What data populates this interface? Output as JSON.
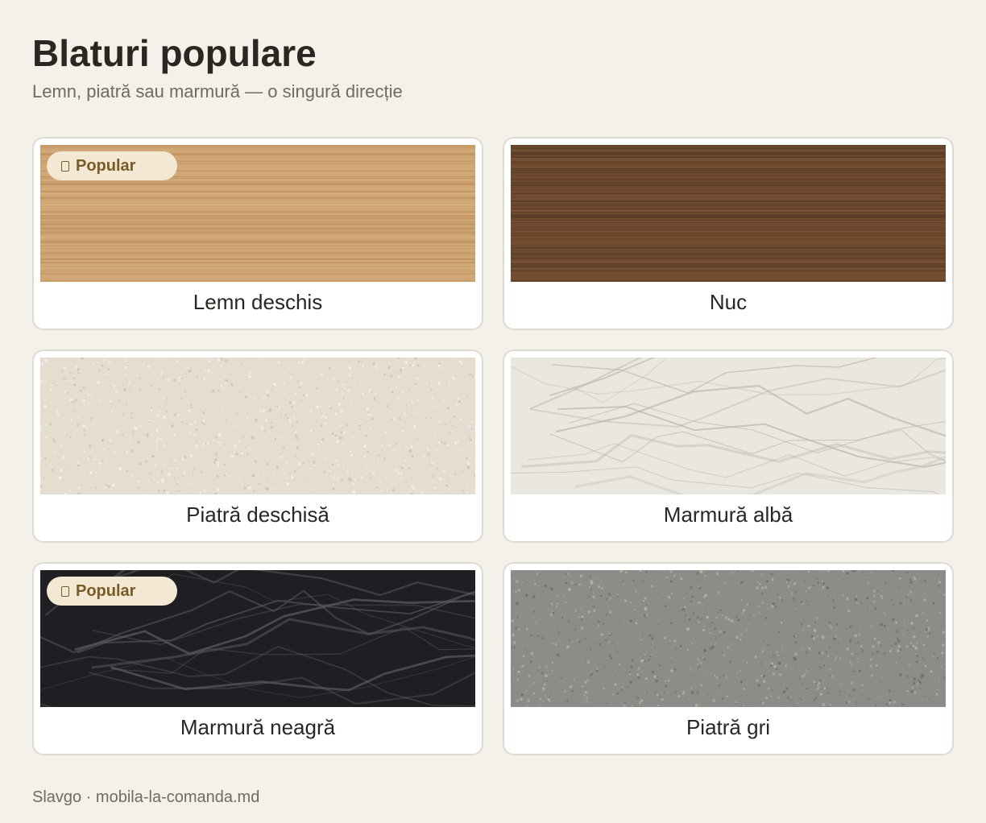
{
  "header": {
    "title": "Blaturi populare",
    "subtitle": "Lemn, piatră sau marmură — o singură direcție"
  },
  "badge_label": "Popular",
  "cards": [
    {
      "label": "Lemn deschis",
      "popular": true,
      "texture": "wood",
      "colors": {
        "base": "#cea472",
        "light": "#dbb485",
        "dark": "#b98b57"
      }
    },
    {
      "label": "Nuc",
      "popular": false,
      "texture": "wood",
      "colors": {
        "base": "#6e4a2f",
        "light": "#7e5738",
        "dark": "#4f321f"
      }
    },
    {
      "label": "Piatră deschisă",
      "popular": false,
      "texture": "stone",
      "colors": {
        "base": "#e4ddd0",
        "light": "#f7f3ea",
        "dark": "#c9c0b1"
      }
    },
    {
      "label": "Marmură albă",
      "popular": false,
      "texture": "marble",
      "colors": {
        "base": "#eae7e1",
        "light": "#ffffff",
        "dark": "#bdb9b2"
      }
    },
    {
      "label": "Marmură neagră",
      "popular": true,
      "texture": "marble",
      "colors": {
        "base": "#1f1f23",
        "light": "#4d4d53",
        "dark": "#5a5a60"
      }
    },
    {
      "label": "Piatră gri",
      "popular": false,
      "texture": "stone",
      "colors": {
        "base": "#8e8c89",
        "light": "#b6b3ae",
        "dark": "#6d6b68"
      }
    }
  ],
  "footer": "Slavgo · mobila-la-comanda.md"
}
